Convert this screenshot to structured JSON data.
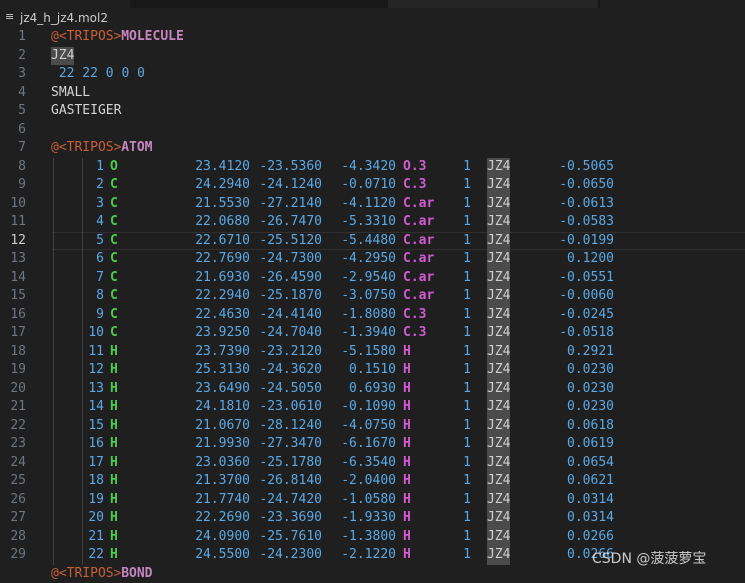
{
  "breadcrumb": {
    "filename": "jz4_h_jz4.mol2",
    "icon": "lines-file-icon"
  },
  "colors": {
    "background": "#1f1f1f",
    "line_number": "#6e7681",
    "tripos_tag": "#c75f38",
    "section": "#c586c0",
    "number": "#5aa9e6",
    "element": "#4ec94e",
    "atom_type": "#d25ad2"
  },
  "header_lines": [
    {
      "num": "1",
      "tag": "@<TRIPOS>",
      "section": "MOLECULE"
    },
    {
      "num": "2",
      "text": "JZ4"
    },
    {
      "num": "3",
      "text": " 22 22 0 0 0"
    },
    {
      "num": "4",
      "text": "SMALL"
    },
    {
      "num": "5",
      "text": "GASTEIGER"
    },
    {
      "num": "6",
      "text": ""
    },
    {
      "num": "7",
      "tag": "@<TRIPOS>",
      "section": "ATOM"
    }
  ],
  "atoms": [
    {
      "line": "8",
      "id": "1",
      "el": "O",
      "x": "23.4120",
      "y": "-23.5360",
      "z": "-4.3420",
      "type": "O.3",
      "subst": "1",
      "res": "JZ4",
      "charge": "-0.5065"
    },
    {
      "line": "9",
      "id": "2",
      "el": "C",
      "x": "24.2940",
      "y": "-24.1240",
      "z": "-0.0710",
      "type": "C.3",
      "subst": "1",
      "res": "JZ4",
      "charge": "-0.0650"
    },
    {
      "line": "10",
      "id": "3",
      "el": "C",
      "x": "21.5530",
      "y": "-27.2140",
      "z": "-4.1120",
      "type": "C.ar",
      "subst": "1",
      "res": "JZ4",
      "charge": "-0.0613"
    },
    {
      "line": "11",
      "id": "4",
      "el": "C",
      "x": "22.0680",
      "y": "-26.7470",
      "z": "-5.3310",
      "type": "C.ar",
      "subst": "1",
      "res": "JZ4",
      "charge": "-0.0583"
    },
    {
      "line": "12",
      "id": "5",
      "el": "C",
      "x": "22.6710",
      "y": "-25.5120",
      "z": "-5.4480",
      "type": "C.ar",
      "subst": "1",
      "res": "JZ4",
      "charge": "-0.0199"
    },
    {
      "line": "13",
      "id": "6",
      "el": "C",
      "x": "22.7690",
      "y": "-24.7300",
      "z": "-4.2950",
      "type": "C.ar",
      "subst": "1",
      "res": "JZ4",
      "charge": "0.1200"
    },
    {
      "line": "14",
      "id": "7",
      "el": "C",
      "x": "21.6930",
      "y": "-26.4590",
      "z": "-2.9540",
      "type": "C.ar",
      "subst": "1",
      "res": "JZ4",
      "charge": "-0.0551"
    },
    {
      "line": "15",
      "id": "8",
      "el": "C",
      "x": "22.2940",
      "y": "-25.1870",
      "z": "-3.0750",
      "type": "C.ar",
      "subst": "1",
      "res": "JZ4",
      "charge": "-0.0060"
    },
    {
      "line": "16",
      "id": "9",
      "el": "C",
      "x": "22.4630",
      "y": "-24.4140",
      "z": "-1.8080",
      "type": "C.3",
      "subst": "1",
      "res": "JZ4",
      "charge": "-0.0245"
    },
    {
      "line": "17",
      "id": "10",
      "el": "C",
      "x": "23.9250",
      "y": "-24.7040",
      "z": "-1.3940",
      "type": "C.3",
      "subst": "1",
      "res": "JZ4",
      "charge": "-0.0518"
    },
    {
      "line": "18",
      "id": "11",
      "el": "H",
      "x": "23.7390",
      "y": "-23.2120",
      "z": "-5.1580",
      "type": "H",
      "subst": "1",
      "res": "JZ4",
      "charge": "0.2921"
    },
    {
      "line": "19",
      "id": "12",
      "el": "H",
      "x": "25.3130",
      "y": "-24.3620",
      "z": "0.1510",
      "type": "H",
      "subst": "1",
      "res": "JZ4",
      "charge": "0.0230"
    },
    {
      "line": "20",
      "id": "13",
      "el": "H",
      "x": "23.6490",
      "y": "-24.5050",
      "z": "0.6930",
      "type": "H",
      "subst": "1",
      "res": "JZ4",
      "charge": "0.0230"
    },
    {
      "line": "21",
      "id": "14",
      "el": "H",
      "x": "24.1810",
      "y": "-23.0610",
      "z": "-0.1090",
      "type": "H",
      "subst": "1",
      "res": "JZ4",
      "charge": "0.0230"
    },
    {
      "line": "22",
      "id": "15",
      "el": "H",
      "x": "21.0670",
      "y": "-28.1240",
      "z": "-4.0750",
      "type": "H",
      "subst": "1",
      "res": "JZ4",
      "charge": "0.0618"
    },
    {
      "line": "23",
      "id": "16",
      "el": "H",
      "x": "21.9930",
      "y": "-27.3470",
      "z": "-6.1670",
      "type": "H",
      "subst": "1",
      "res": "JZ4",
      "charge": "0.0619"
    },
    {
      "line": "24",
      "id": "17",
      "el": "H",
      "x": "23.0360",
      "y": "-25.1780",
      "z": "-6.3540",
      "type": "H",
      "subst": "1",
      "res": "JZ4",
      "charge": "0.0654"
    },
    {
      "line": "25",
      "id": "18",
      "el": "H",
      "x": "21.3700",
      "y": "-26.8140",
      "z": "-2.0400",
      "type": "H",
      "subst": "1",
      "res": "JZ4",
      "charge": "0.0621"
    },
    {
      "line": "26",
      "id": "19",
      "el": "H",
      "x": "21.7740",
      "y": "-24.7420",
      "z": "-1.0580",
      "type": "H",
      "subst": "1",
      "res": "JZ4",
      "charge": "0.0314"
    },
    {
      "line": "27",
      "id": "20",
      "el": "H",
      "x": "22.2690",
      "y": "-23.3690",
      "z": "-1.9330",
      "type": "H",
      "subst": "1",
      "res": "JZ4",
      "charge": "0.0314"
    },
    {
      "line": "28",
      "id": "21",
      "el": "H",
      "x": "24.0900",
      "y": "-25.7610",
      "z": "-1.3800",
      "type": "H",
      "subst": "1",
      "res": "JZ4",
      "charge": "0.0266"
    },
    {
      "line": "29",
      "id": "22",
      "el": "H",
      "x": "24.5500",
      "y": "-24.2300",
      "z": "-2.1220",
      "type": "H",
      "subst": "1",
      "res": "JZ4",
      "charge": "0.0266"
    }
  ],
  "next_section": {
    "tag": "@<TRIPOS>",
    "section": "BOND"
  },
  "current_line": "12",
  "watermark": "CSDN @菠菠萝宝"
}
